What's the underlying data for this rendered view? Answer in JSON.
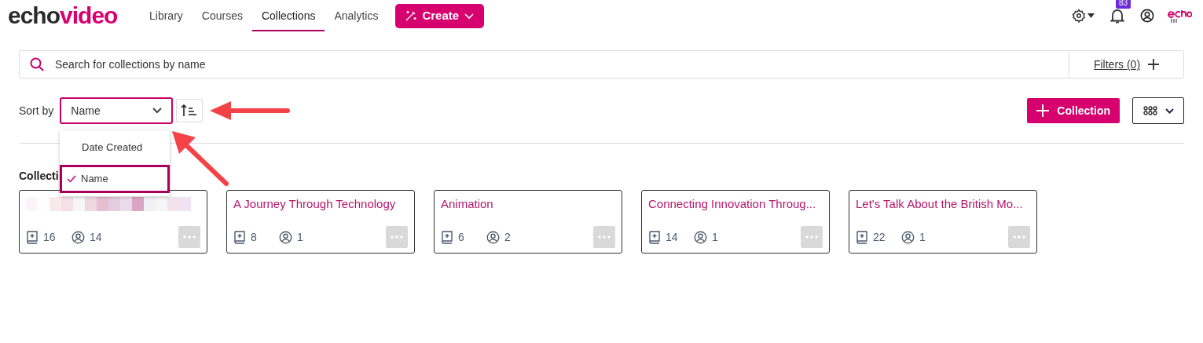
{
  "logo": {
    "part_1": "echo",
    "part_2": "video"
  },
  "nav": {
    "tabs": [
      {
        "label": "Library",
        "selected": false
      },
      {
        "label": "Courses",
        "selected": false
      },
      {
        "label": "Collections",
        "selected": true
      },
      {
        "label": "Analytics",
        "selected": false
      }
    ],
    "create_button": "Create",
    "notification_count": "83"
  },
  "search": {
    "placeholder": "Search for collections by name",
    "filters": "Filters (0)"
  },
  "sort": {
    "label": "Sort by",
    "value": "Name",
    "options": [
      {
        "label": "Date Created",
        "selected": false
      },
      {
        "label": "Name",
        "selected": true
      }
    ]
  },
  "add_button": "Collection",
  "heading": "Collecti",
  "collections": [
    {
      "kind": "blurred",
      "media": "16",
      "members": "14"
    },
    {
      "kind": "titled",
      "title": "A Journey Through Technology",
      "media": "8",
      "members": "1"
    },
    {
      "kind": "titled",
      "title": "Animation",
      "media": "6",
      "members": "2"
    },
    {
      "kind": "titled",
      "title": "Connecting Innovation Throug...",
      "media": "14",
      "members": "1"
    },
    {
      "kind": "titled",
      "title": "Let's Talk About the British Mo...",
      "media": "22",
      "members": "1"
    }
  ]
}
